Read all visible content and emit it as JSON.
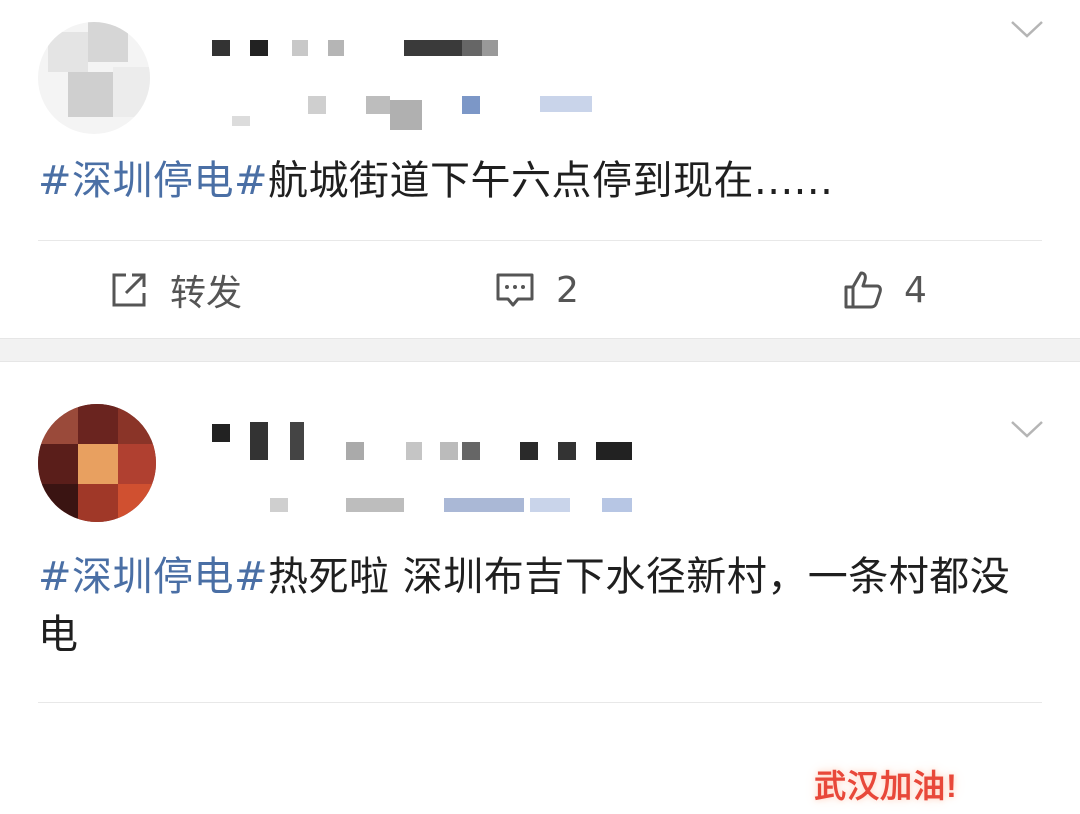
{
  "posts": [
    {
      "topic_tag": "#深圳停电#",
      "text": "航城街道下午六点停到现在......",
      "actions": {
        "repost_label": "转发",
        "comment_count": "2",
        "like_count": "4"
      }
    },
    {
      "topic_tag": "#深圳停电#",
      "text": "热死啦 深圳布吉下水径新村，一条村都没电",
      "badge": "武汉加油!"
    }
  ],
  "icons": {
    "repost": "repost-icon",
    "comment": "comment-icon",
    "like": "thumbs-up-icon",
    "menu": "chevron-down-icon"
  },
  "colors": {
    "topic": "#4a6fa5",
    "badge": "#e8483a"
  }
}
